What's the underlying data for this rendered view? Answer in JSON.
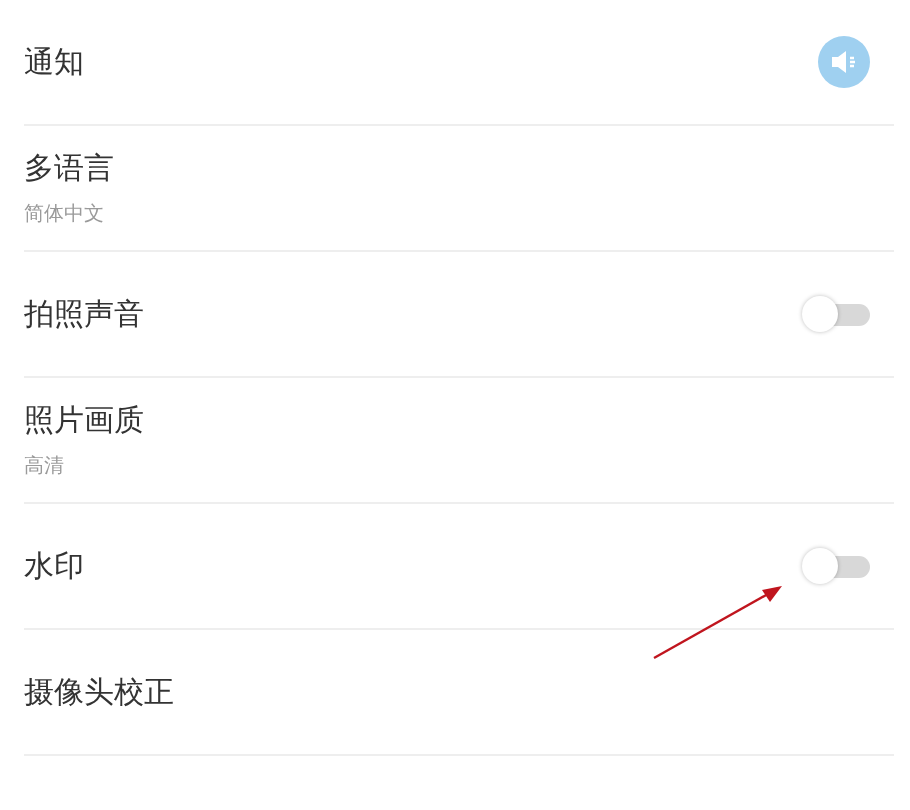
{
  "settings": [
    {
      "kind": "icon",
      "label": "通知"
    },
    {
      "kind": "value",
      "label": "多语言",
      "value": "简体中文"
    },
    {
      "kind": "toggle",
      "label": "拍照声音",
      "on": false
    },
    {
      "kind": "value",
      "label": "照片画质",
      "value": "高清"
    },
    {
      "kind": "toggle",
      "label": "水印",
      "on": false
    },
    {
      "kind": "plain",
      "label": "摄像头校正"
    }
  ],
  "annotations": [
    {
      "kind": "arrow",
      "color": "#c0151e"
    }
  ]
}
